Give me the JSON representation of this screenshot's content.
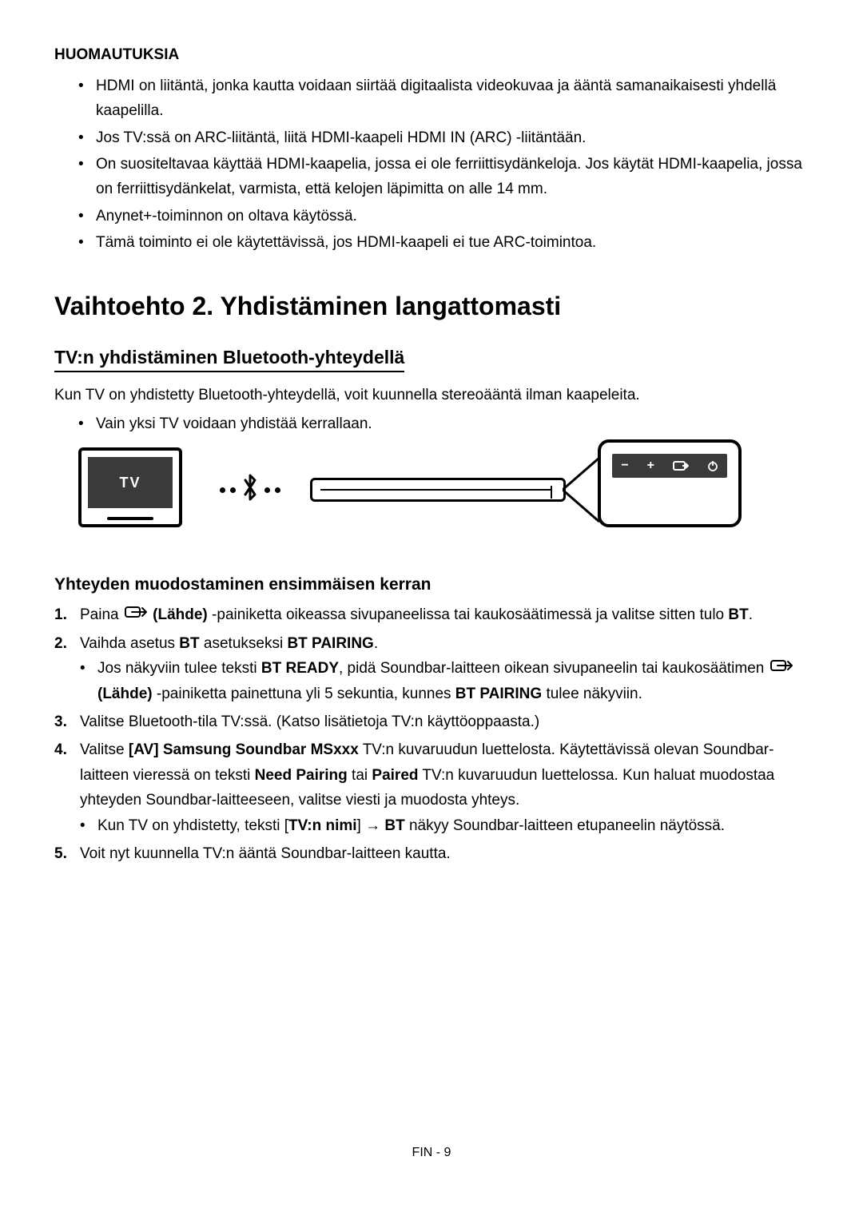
{
  "notes": {
    "heading": "HUOMAUTUKSIA",
    "items": [
      "HDMI on liitäntä, jonka kautta voidaan siirtää digitaalista videokuvaa ja ääntä samanaikaisesti yhdellä kaapelilla.",
      "Jos TV:ssä on ARC-liitäntä, liitä HDMI-kaapeli HDMI IN (ARC) -liitäntään.",
      "On suositeltavaa käyttää HDMI-kaapelia, jossa ei ole ferriittisydänkeloja. Jos käytät HDMI-kaapelia, jossa on ferriittisydänkelat, varmista, että kelojen läpimitta on alle 14 mm.",
      "Anynet+-toiminnon on oltava käytössä.",
      "Tämä toiminto ei ole käytettävissä, jos HDMI-kaapeli ei tue ARC-toimintoa."
    ]
  },
  "option2_heading": "Vaihtoehto 2. Yhdistäminen langattomasti",
  "bt_section_heading": "TV:n yhdistäminen Bluetooth-yhteydellä",
  "bt_intro": "Kun TV on yhdistetty Bluetooth-yhteydellä, voit kuunnella stereoääntä ilman kaapeleita.",
  "bt_intro_bullets": [
    "Vain yksi TV voidaan yhdistää kerrallaan."
  ],
  "diagram": {
    "tv_label": "TV",
    "panel_symbols": {
      "minus": "−",
      "plus": "+",
      "source_icon": "source-icon",
      "power_icon": "power-icon"
    }
  },
  "first_time_heading": "Yhteyden muodostaminen ensimmäisen kerran",
  "source_label": "(Lähde)",
  "steps": {
    "s1": {
      "pre": "Paina ",
      "mid": " -painiketta oikeassa sivupaneelissa tai kaukosäätimessä ja valitse sitten tulo ",
      "bt": "BT",
      "end": "."
    },
    "s2": {
      "pre": "Vaihda asetus ",
      "b1": "BT",
      "mid": " asetukseksi ",
      "b2": "BT PAIRING",
      "end": ".",
      "sub": {
        "pre": "Jos näkyviin tulee teksti ",
        "b1": "BT READY",
        "mid1": ", pidä Soundbar-laitteen oikean sivupaneelin tai kaukosäätimen ",
        "mid2": " -painiketta painettuna yli 5 sekuntia, kunnes ",
        "b2": "BT PAIRING",
        "end": " tulee näkyviin."
      }
    },
    "s3": "Valitse Bluetooth-tila TV:ssä. (Katso lisätietoja TV:n käyttöoppaasta.)",
    "s4": {
      "pre": "Valitse ",
      "b1": "[AV] Samsung Soundbar MSxxx",
      "mid1": " TV:n kuvaruudun luettelosta. Käytettävissä olevan Soundbar-laitteen vieressä on teksti ",
      "b2": "Need Pairing",
      "mid2": " tai ",
      "b3": "Paired",
      "end": " TV:n kuvaruudun luettelossa. Kun haluat muodostaa yhteyden Soundbar-laitteeseen, valitse viesti ja muodosta yhteys.",
      "sub": {
        "pre": "Kun TV on yhdistetty, teksti [",
        "b1": "TV:n nimi",
        "mid": "] → ",
        "b2": "BT",
        "end": " näkyy Soundbar-laitteen etupaneelin näytössä."
      }
    },
    "s5": "Voit nyt kuunnella TV:n ääntä Soundbar-laitteen kautta."
  },
  "footer": "FIN - 9"
}
